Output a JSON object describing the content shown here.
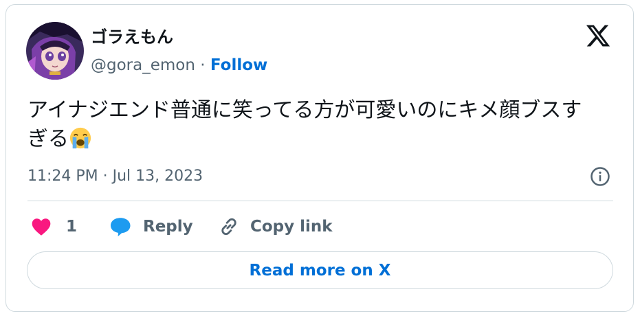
{
  "author": {
    "display_name": "ゴラえもん",
    "handle": "@gora_emon",
    "separator": "·",
    "follow_label": "Follow"
  },
  "tweet": {
    "text": "アイナジエンド普通に笑ってる方が可愛いのにキメ顔ブスすぎる",
    "emoji": "loudly-crying-face",
    "timestamp": "11:24 PM · Jul 13, 2023"
  },
  "actions": {
    "like_count": "1",
    "reply_label": "Reply",
    "copy_link_label": "Copy link"
  },
  "read_more_label": "Read more on X",
  "colors": {
    "like": "#f91880",
    "reply": "#1d9bf0",
    "link": "#006fd6",
    "secondary_text": "#536471",
    "border": "#cfd9de"
  }
}
